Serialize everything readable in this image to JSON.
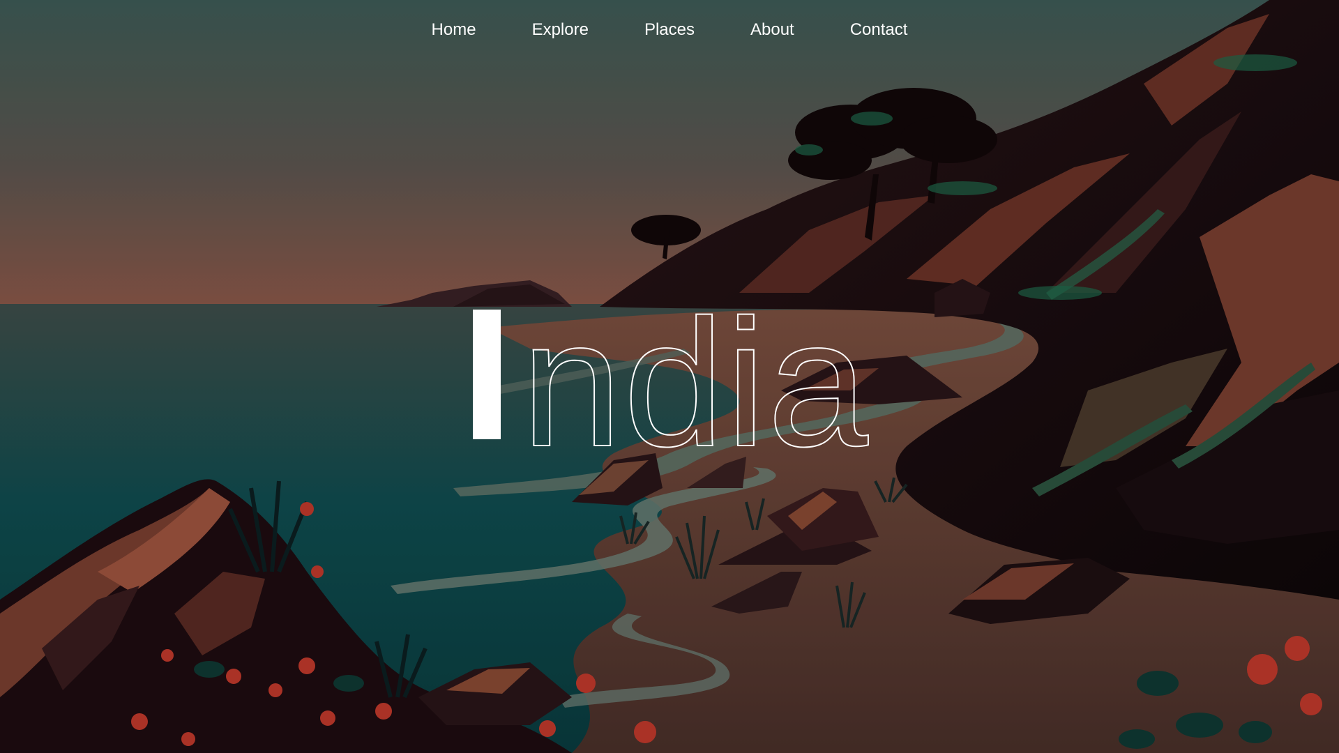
{
  "nav": {
    "items": [
      {
        "label": "Home"
      },
      {
        "label": "Explore"
      },
      {
        "label": "Places"
      },
      {
        "label": "About"
      },
      {
        "label": "Contact"
      }
    ]
  },
  "hero": {
    "title": "ndia",
    "first_letter": "I"
  },
  "colors": {
    "sky_top": "#3f5d57",
    "sky_horizon": "#8a5a4c",
    "sea": "#0f4f52",
    "surf": "#6b7f75",
    "sand": "#6e4a3e",
    "rock_dark": "#1e0f12",
    "rock_light": "#7a3f30",
    "flower": "#c2392c",
    "text": "#ffffff"
  }
}
